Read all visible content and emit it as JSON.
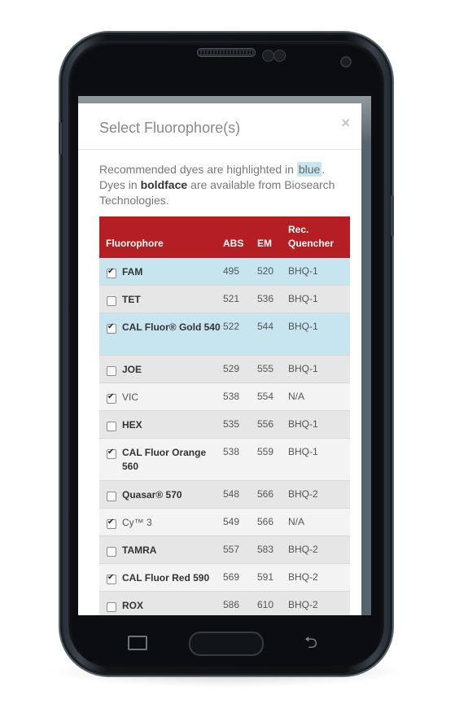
{
  "modal": {
    "title": "Select Fluorophore(s)",
    "close": "×"
  },
  "intro": {
    "part1": "Recommended dyes are highlighted in ",
    "blue_word": "blue",
    "part2": ". Dyes in ",
    "bold_word": "boldface",
    "part3": " are available from Biosearch Technologies."
  },
  "table": {
    "headers": {
      "fluorophore": "Fluorophore",
      "abs": "ABS",
      "em": "EM",
      "quencher_line1": "Rec.",
      "quencher_line2": "Quencher"
    },
    "rows": [
      {
        "name": "FAM",
        "abs": "495",
        "em": "520",
        "quencher": "BHQ-1",
        "checked": true,
        "bold": true,
        "recommended": true
      },
      {
        "name": "TET",
        "abs": "521",
        "em": "536",
        "quencher": "BHQ-1",
        "checked": false,
        "bold": true,
        "recommended": false
      },
      {
        "name": "CAL Fluor® Gold 540",
        "abs": "522",
        "em": "544",
        "quencher": "BHQ-1",
        "checked": true,
        "bold": true,
        "recommended": true
      },
      {
        "name": "JOE",
        "abs": "529",
        "em": "555",
        "quencher": "BHQ-1",
        "checked": false,
        "bold": true,
        "recommended": false
      },
      {
        "name": "VIC",
        "abs": "538",
        "em": "554",
        "quencher": "N/A",
        "checked": true,
        "bold": false,
        "recommended": false
      },
      {
        "name": "HEX",
        "abs": "535",
        "em": "556",
        "quencher": "BHQ-1",
        "checked": false,
        "bold": true,
        "recommended": false
      },
      {
        "name": "CAL Fluor Orange 560",
        "abs": "538",
        "em": "559",
        "quencher": "BHQ-1",
        "checked": true,
        "bold": true,
        "recommended": false
      },
      {
        "name": "Quasar® 570",
        "abs": "548",
        "em": "566",
        "quencher": "BHQ-2",
        "checked": false,
        "bold": true,
        "recommended": false
      },
      {
        "name": "Cy™ 3",
        "abs": "549",
        "em": "566",
        "quencher": "N/A",
        "checked": true,
        "bold": false,
        "recommended": false
      },
      {
        "name": "TAMRA",
        "abs": "557",
        "em": "583",
        "quencher": "BHQ-2",
        "checked": false,
        "bold": true,
        "recommended": false
      },
      {
        "name": "CAL Fluor Red 590",
        "abs": "569",
        "em": "591",
        "quencher": "BHQ-2",
        "checked": true,
        "bold": true,
        "recommended": false
      },
      {
        "name": "ROX",
        "abs": "586",
        "em": "610",
        "quencher": "BHQ-2",
        "checked": false,
        "bold": true,
        "recommended": false
      }
    ]
  },
  "colors": {
    "header_red": "#b51f24",
    "recommended_blue": "#c6e5ef",
    "row_gray_dark": "#e6e6e6",
    "row_gray_light": "#f3f3f3"
  },
  "icons": [
    "close-icon",
    "checkbox-icon",
    "recent-apps-icon",
    "home-button",
    "back-icon"
  ]
}
